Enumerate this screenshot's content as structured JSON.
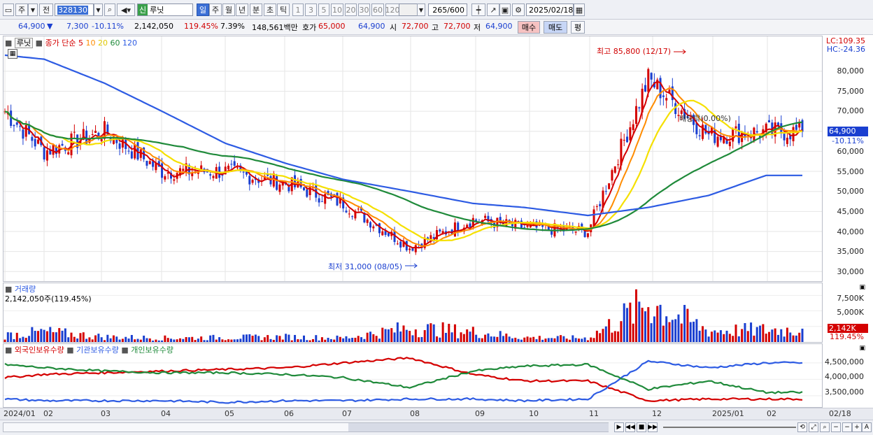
{
  "toolbar": {
    "period_letter": "주",
    "full_label": "전",
    "code": "328130",
    "stock_badge": "신",
    "stock_name": "루닛",
    "intervals": [
      "일",
      "주",
      "월",
      "년",
      "분",
      "초",
      "틱"
    ],
    "numbers": [
      "1",
      "3",
      "5",
      "10",
      "20",
      "30",
      "60",
      "120"
    ],
    "count": "265",
    "count_total": "/600",
    "date": "2025/02/18"
  },
  "quote": {
    "price": "64,900",
    "arrow": "▼",
    "change": "7,300",
    "change_rate": "-10.11%",
    "volume": "2,142,050",
    "vol_ratio": "119.45%",
    "turnover": "7.39%",
    "amount": "148,561백만",
    "bid_label": "호가",
    "bid1": "65,000",
    "bid2": "64,900",
    "open_label": "시",
    "open": "72,700",
    "high_label": "고",
    "high": "72,700",
    "low_label": "저",
    "low": "64,900",
    "buy": "매수",
    "sell": "매도",
    "eval": "평"
  },
  "price_panel": {
    "name": "루닛",
    "ma_label": "종가 단순",
    "ma_periods": [
      "5",
      "10",
      "20",
      "60",
      "120"
    ],
    "ma_colors": [
      "#d40000",
      "#ff8c00",
      "#f5e000",
      "#1f8a3a",
      "#2d5be3"
    ],
    "lc": "LC:109.35",
    "hc": "HC:-24.36",
    "high_annot": "최고 85,800 (12/17)",
    "low_annot": "최저 31,000 (08/05)",
    "dividend_annot": "배당락(0.00%)",
    "last_price": "64,900",
    "last_change": "-10.11%",
    "y_ticks": [
      "80,000",
      "75,000",
      "70,000",
      "65,000",
      "60,000",
      "55,000",
      "50,000",
      "45,000",
      "40,000",
      "35,000",
      "30,000"
    ]
  },
  "volume_panel": {
    "title": "거래량",
    "value": "2,142,050주(119.45%)",
    "ticks": [
      "7,500K",
      "5,000K",
      "2,500K"
    ],
    "last": "2,142K",
    "last_pct": "119.45%"
  },
  "holding_panel": {
    "legend": [
      "외국인보유수량",
      "기관보유수량",
      "개인보유수량"
    ],
    "legend_colors": [
      "#d40000",
      "#2d5be3",
      "#1f8a3a"
    ],
    "ticks": [
      "4,500,000",
      "4,000,000",
      "3,500,000"
    ]
  },
  "dates": [
    "2024/01",
    "02",
    "03",
    "04",
    "05",
    "06",
    "07",
    "08",
    "09",
    "10",
    "11",
    "12",
    "2025/01",
    "02"
  ],
  "last_date": "02/18",
  "chart_data": {
    "type": "candlestick",
    "x": [
      "2024-01",
      "2024-02",
      "2024-03",
      "2024-04",
      "2024-05",
      "2024-06",
      "2024-07",
      "2024-08",
      "2024-09",
      "2024-10",
      "2024-11",
      "2024-12",
      "2025-01",
      "2025-02"
    ],
    "close_approx": [
      70000,
      60000,
      65000,
      55000,
      55000,
      52000,
      47000,
      36000,
      43000,
      41000,
      40000,
      78000,
      64000,
      64900
    ],
    "ma120_approx": [
      84000,
      83000,
      77000,
      70000,
      62000,
      57000,
      53000,
      50000,
      47000,
      46000,
      44000,
      46000,
      49000,
      54000
    ],
    "volume_k_approx": [
      1200,
      1800,
      900,
      700,
      800,
      900,
      700,
      2500,
      1800,
      800,
      700,
      7000,
      2000,
      2142
    ],
    "ylim": [
      29000,
      88000
    ],
    "high": {
      "value": 85800,
      "date": "12/17"
    },
    "low": {
      "value": 31000,
      "date": "08/05"
    }
  }
}
